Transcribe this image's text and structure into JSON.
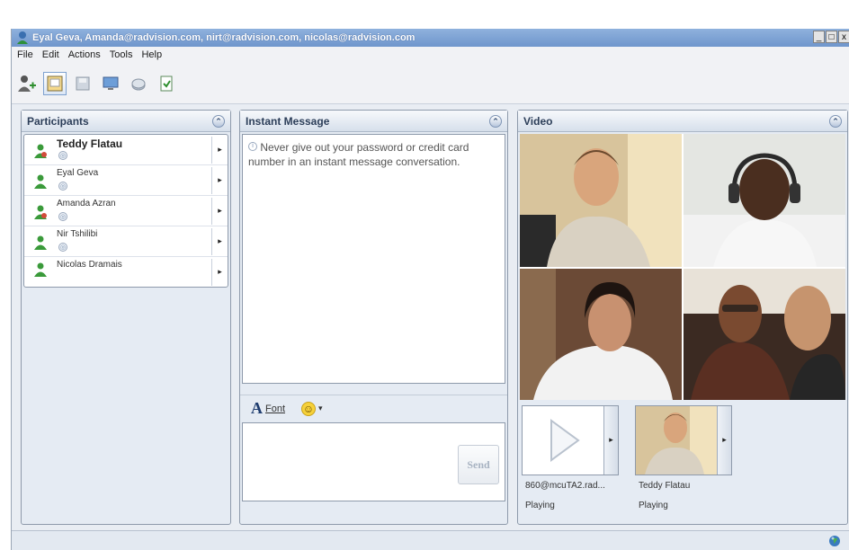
{
  "window": {
    "title": "Eyal Geva, Amanda@radvision.com, nirt@radvision.com, nicolas@radvision.com",
    "controls": [
      "_",
      "□",
      "x"
    ]
  },
  "menu": [
    "File",
    "Edit",
    "Actions",
    "Tools",
    "Help"
  ],
  "toolbar": {
    "icons": [
      "add-participant-icon",
      "pictures-icon",
      "save-icon",
      "monitor-icon",
      "disk-icon",
      "sheet-icon"
    ]
  },
  "participants": {
    "title": "Participants",
    "collapse_glyph": "⌃",
    "items": [
      {
        "name": "Teddy Flatau",
        "status_glyph": "◎",
        "arrow": "▸"
      },
      {
        "name": "Eyal Geva",
        "status_glyph": "◎",
        "arrow": "▸"
      },
      {
        "name": "Amanda Azran",
        "status_glyph": "◎",
        "arrow": "▸"
      },
      {
        "name": "Nir Tshilibi",
        "status_glyph": "◎",
        "arrow": "▸"
      },
      {
        "name": "Nicolas Dramais",
        "arrow": "▸"
      }
    ]
  },
  "instant_message": {
    "title": "Instant Message",
    "collapse_glyph": "⌃",
    "notice": "Never give out your password or credit card number in an instant message conversation.",
    "font_label": "Font",
    "font_glyph": "A",
    "emoji_glyph": "☺",
    "emoji_menu_glyph": "▾",
    "input_value": "",
    "send_label": "Send"
  },
  "video": {
    "title": "Video",
    "collapse_glyph": "⌃",
    "thumbnails": [
      {
        "label": "860@mcuTA2.rad...",
        "status": "Playing",
        "arrow": "▸"
      },
      {
        "label": "Teddy Flatau",
        "status": "Playing",
        "arrow": "▸"
      }
    ]
  },
  "colors": {
    "titlebar": "#7fa3d6",
    "panel_bg": "#e5ebf3",
    "header_text": "#2c3e59",
    "accent_green": "#3a9a3a"
  }
}
